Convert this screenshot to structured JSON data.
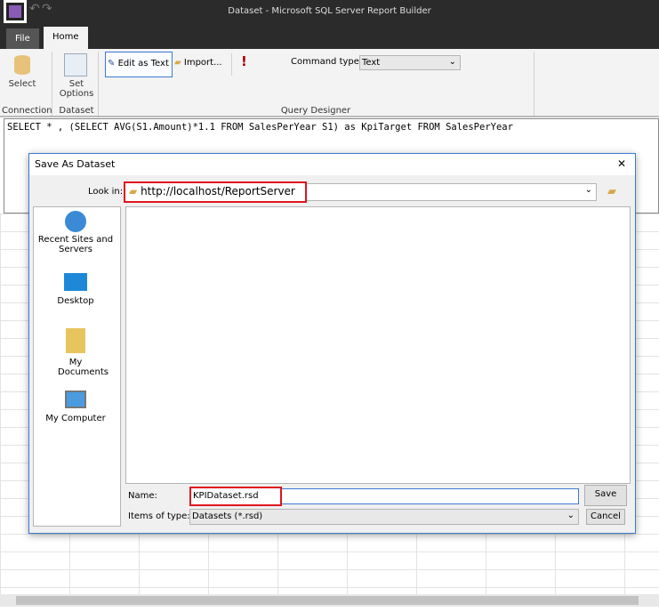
{
  "app": {
    "title": "Dataset - Microsoft SQL Server Report Builder"
  },
  "tabs": {
    "file": "File",
    "home": "Home"
  },
  "ribbon": {
    "select": "Select",
    "set_options_1": "Set",
    "set_options_2": "Options",
    "edit_as_text": "Edit as Text",
    "import": "Import...",
    "command_type_label": "Command type:",
    "command_type_value": "Text",
    "groups": {
      "connection": "Connection",
      "dataset": "Dataset",
      "query_designer": "Query Designer"
    }
  },
  "query": "SELECT * , (SELECT AVG(S1.Amount)*1.1 FROM SalesPerYear S1) as KpiTarget FROM SalesPerYear",
  "dialog": {
    "title": "Save As Dataset",
    "close": "✕",
    "look_in_label": "Look in:",
    "look_in_value": "http://localhost/ReportServer",
    "places": [
      {
        "label": "Recent Sites and Servers"
      },
      {
        "label": "Desktop"
      },
      {
        "label": "My Documents"
      },
      {
        "label": "My Computer"
      }
    ],
    "name_label": "Name:",
    "name_value": "KPIDataset.rsd",
    "type_label": "Items of type:",
    "type_value": "Datasets (*.rsd)",
    "save": "Save",
    "cancel": "Cancel"
  }
}
